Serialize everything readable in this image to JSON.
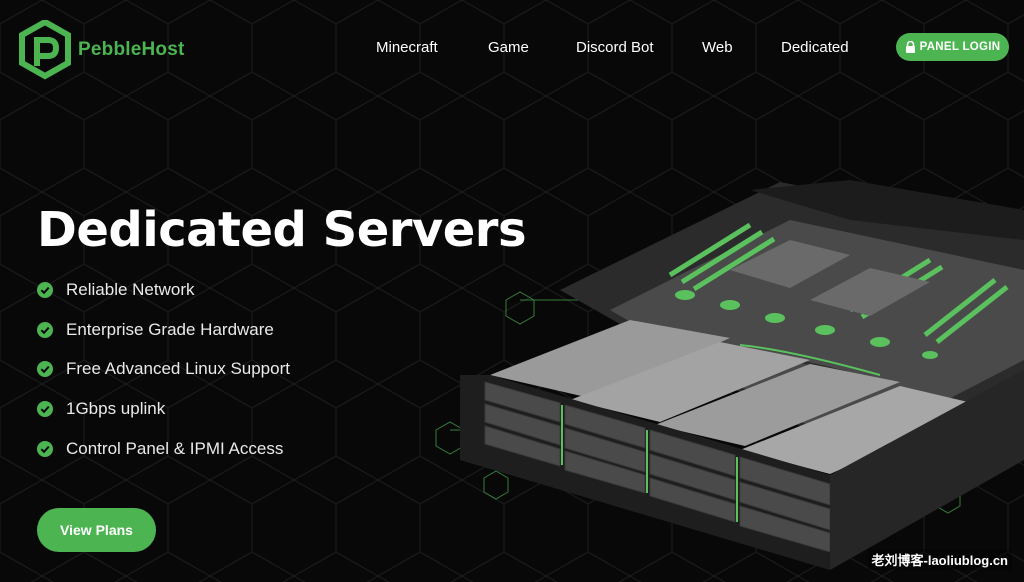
{
  "brand": {
    "name": "PebbleHost",
    "accent": "#4db452"
  },
  "nav": {
    "items": [
      {
        "label": "Minecraft"
      },
      {
        "label": "Game"
      },
      {
        "label": "Discord Bot"
      },
      {
        "label": "Web"
      },
      {
        "label": "Dedicated"
      }
    ],
    "panel_login": {
      "label": "PANEL LOGIN",
      "icon": "lock-icon"
    }
  },
  "hero": {
    "title": "Dedicated Servers",
    "features": [
      "Reliable Network",
      "Enterprise Grade Hardware",
      "Free Advanced Linux Support",
      "1Gbps uplink",
      "Control Panel & IPMI Access"
    ],
    "cta_label": "View Plans"
  },
  "watermark": "老刘博客-laoliublog.cn"
}
